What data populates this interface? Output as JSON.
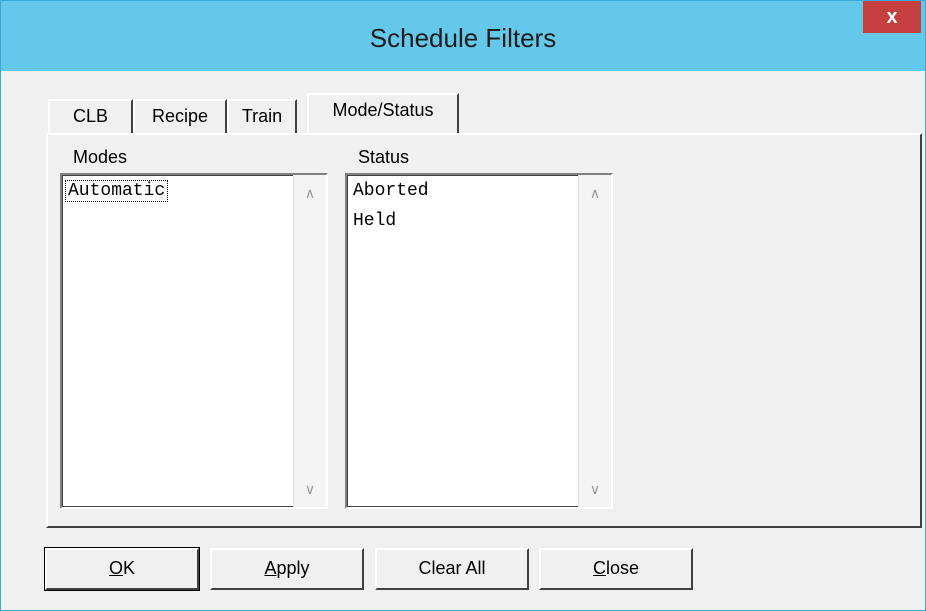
{
  "window": {
    "title": "Schedule Filters",
    "close_glyph": "x"
  },
  "tabs": [
    {
      "label": "CLB",
      "active": false
    },
    {
      "label": "Recipe",
      "active": false
    },
    {
      "label": "Train",
      "active": false
    },
    {
      "label": "Mode/Status",
      "active": true
    }
  ],
  "modes": {
    "label": "Modes",
    "items": [
      "Automatic"
    ]
  },
  "status": {
    "label": "Status",
    "items": [
      "Aborted",
      "Held"
    ]
  },
  "scroll": {
    "up_glyph": "∧",
    "down_glyph": "∨"
  },
  "buttons": {
    "ok": {
      "accel": "O",
      "rest": "K"
    },
    "apply": {
      "accel": "A",
      "rest": "pply"
    },
    "clear_all": {
      "label": "Clear All"
    },
    "close": {
      "accel": "C",
      "rest": "lose"
    }
  },
  "colors": {
    "titlebar": "#64c8ea",
    "close_button": "#c74040",
    "face": "#f0f0f0"
  }
}
